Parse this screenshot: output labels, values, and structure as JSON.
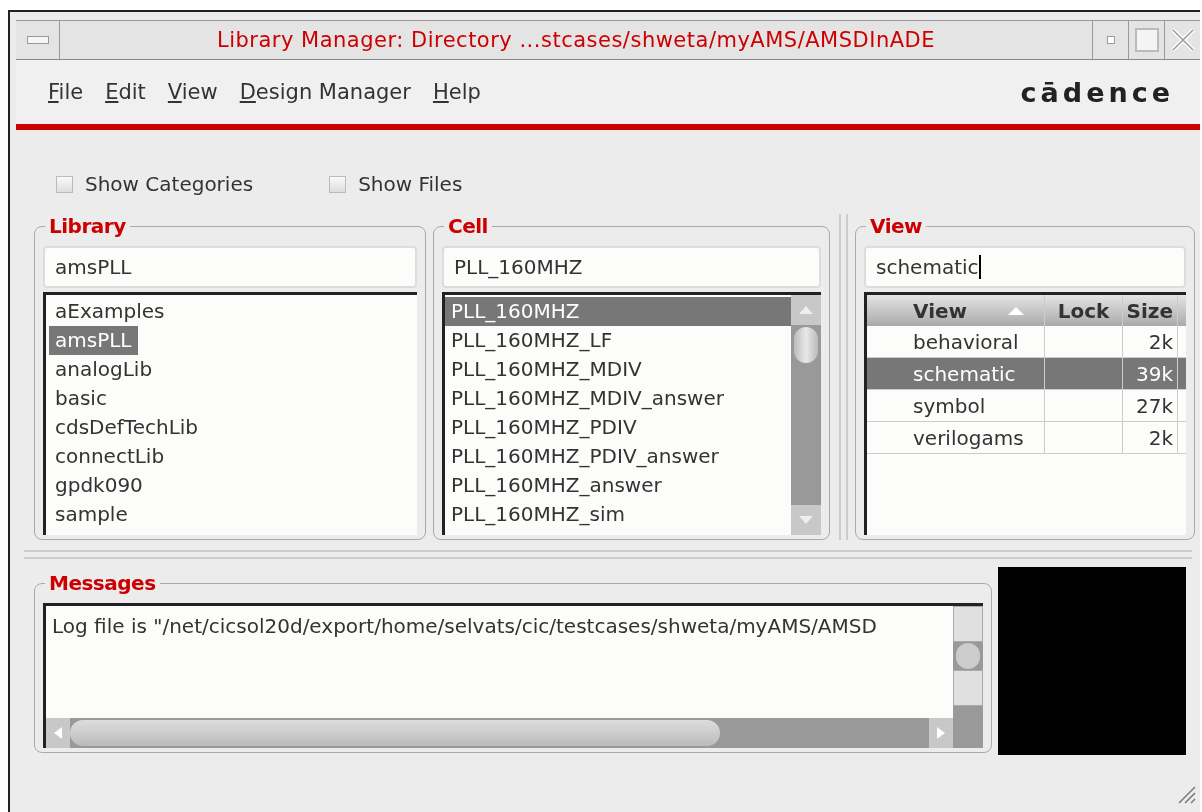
{
  "window": {
    "title": "Library Manager: Directory ...stcases/shweta/myAMS/AMSDInADE"
  },
  "menu": [
    "File",
    "Edit",
    "View",
    "Design Manager",
    "Help"
  ],
  "logo": "cādence",
  "options": [
    {
      "label": "Show Categories",
      "checked": false
    },
    {
      "label": "Show Files",
      "checked": false
    }
  ],
  "library": {
    "title": "Library",
    "value": "amsPLL",
    "items": [
      {
        "label": "aExamples",
        "selected": false
      },
      {
        "label": "amsPLL",
        "selected": true
      },
      {
        "label": "analogLib",
        "selected": false
      },
      {
        "label": "basic",
        "selected": false
      },
      {
        "label": "cdsDefTechLib",
        "selected": false
      },
      {
        "label": "connectLib",
        "selected": false
      },
      {
        "label": "gpdk090",
        "selected": false
      },
      {
        "label": "sample",
        "selected": false
      }
    ]
  },
  "cell": {
    "title": "Cell",
    "value": "PLL_160MHZ",
    "items": [
      {
        "label": "PLL_160MHZ",
        "selected": true
      },
      {
        "label": "PLL_160MHZ_LF",
        "selected": false
      },
      {
        "label": "PLL_160MHZ_MDIV",
        "selected": false
      },
      {
        "label": "PLL_160MHZ_MDIV_answer",
        "selected": false
      },
      {
        "label": "PLL_160MHZ_PDIV",
        "selected": false
      },
      {
        "label": "PLL_160MHZ_PDIV_answer",
        "selected": false
      },
      {
        "label": "PLL_160MHZ_answer",
        "selected": false
      },
      {
        "label": "PLL_160MHZ_sim",
        "selected": false
      }
    ]
  },
  "view": {
    "title": "View",
    "value": "schematic",
    "columns": [
      "View",
      "Lock",
      "Size"
    ],
    "rows": [
      {
        "view": "behavioral",
        "size": "2k",
        "selected": false
      },
      {
        "view": "schematic",
        "size": "39k",
        "selected": true
      },
      {
        "view": "symbol",
        "size": "27k",
        "selected": false
      },
      {
        "view": "verilogams",
        "size": "2k",
        "selected": false
      }
    ]
  },
  "messages": {
    "title": "Messages",
    "text": "Log file is \"/net/cicsol20d/export/home/selvats/cic/testcases/shweta/myAMS/AMSD"
  }
}
